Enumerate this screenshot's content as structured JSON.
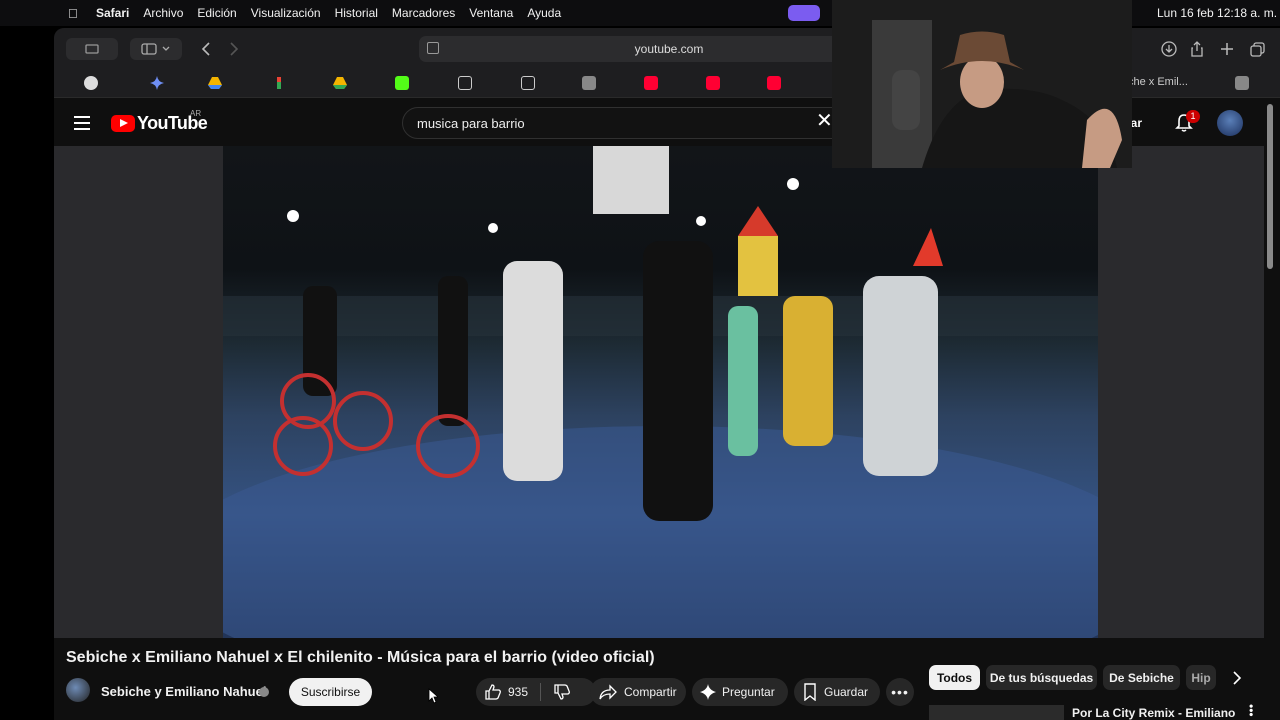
{
  "menubar": {
    "app": "Safari",
    "items": [
      "Archivo",
      "Edición",
      "Visualización",
      "Historial",
      "Marcadores",
      "Ventana",
      "Ayuda"
    ],
    "clock": "Lun 16 feb 12:18 a. m."
  },
  "browser": {
    "url": "youtube.com",
    "tab_label": "che x Emil..."
  },
  "youtube": {
    "search_value": "musica para barrio",
    "country_code": "AR",
    "logo_text": "YouTube",
    "create_label": "ear",
    "notification_count": "1"
  },
  "video": {
    "title": "Sebiche x Emiliano Nahuel x El chilenito - Música para el barrio (video oficial)",
    "channel": "Sebiche y Emiliano Nahuel",
    "subscribe_label": "Suscribirse",
    "likes": "935",
    "share_label": "Compartir",
    "ask_label": "Preguntar",
    "save_label": "Guardar"
  },
  "chips": [
    "Todos",
    "De tus búsquedas",
    "De Sebiche",
    "Hip"
  ],
  "recommendation": {
    "title": "Por La City Remix - Emiliano"
  },
  "colors": {
    "yt_red": "#ff0000",
    "background": "#0f0f0f",
    "chip_bg": "#272727"
  }
}
